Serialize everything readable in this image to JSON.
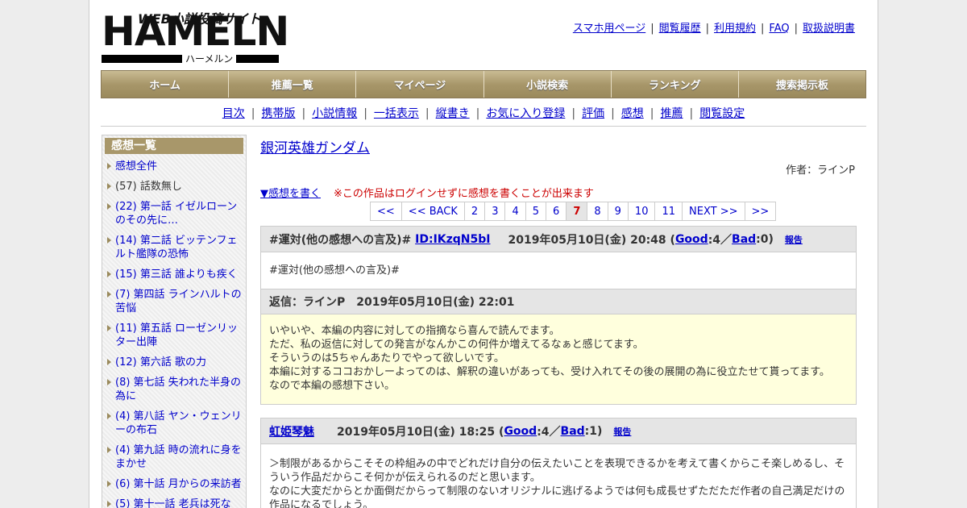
{
  "logo": {
    "main": "HAMELN",
    "web": "WEB小説投稿サイト",
    "kana": "ハーメルン"
  },
  "toplinks": [
    "スマホ用ページ",
    "閲覧履歴",
    "利用規約",
    "FAQ",
    "取扱説明書"
  ],
  "gnav": [
    "ホーム",
    "推薦一覧",
    "マイページ",
    "小説検索",
    "ランキング",
    "捜索掲示板"
  ],
  "subnav": [
    "目次",
    "携帯版",
    "小説情報",
    "一括表示",
    "縦書き",
    "お気に入り登録",
    "評価",
    "感想",
    "推薦",
    "閲覧設定"
  ],
  "sidebar": {
    "title": "感想一覧",
    "items": [
      {
        "label": "感想全件",
        "link": true
      },
      {
        "label": "(57) 話数無し",
        "link": false
      },
      {
        "label": "(22) 第一話 イゼルローンのその先に…",
        "link": true
      },
      {
        "label": "(14) 第二話 ビッテンフェルト艦隊の恐怖",
        "link": true
      },
      {
        "label": "(15) 第三話 誰よりも疾く",
        "link": true
      },
      {
        "label": "(7) 第四話 ラインハルトの苦悩",
        "link": true
      },
      {
        "label": "(11) 第五話 ローゼンリッター出陣",
        "link": true
      },
      {
        "label": "(12) 第六話 歌の力",
        "link": true
      },
      {
        "label": "(8) 第七話 失われた半身の為に",
        "link": true
      },
      {
        "label": "(4) 第八話 ヤン・ウェンリーの布石",
        "link": true
      },
      {
        "label": "(4) 第九話 時の流れに身をまかせ",
        "link": true
      },
      {
        "label": "(6) 第十話 月からの来訪者",
        "link": true
      },
      {
        "label": "(5) 第十一話 老兵は死な",
        "link": true
      }
    ]
  },
  "main": {
    "title": "銀河英雄ガンダム",
    "author": "作者：ラインP",
    "write_link": "▼感想を書く",
    "write_note": "※この作品はログインせずに感想を書くことが出来ます",
    "pager": [
      "<<",
      "<< BACK",
      "2",
      "3",
      "4",
      "5",
      "6",
      "7",
      "8",
      "9",
      "10",
      "11",
      "NEXT >>",
      ">>"
    ],
    "pager_current": "7"
  },
  "comments": [
    {
      "user": "#運対(他の感想への言及)#",
      "id": "ID:IKzqN5bI",
      "date_prefix": "2019年05月10日(金) 20:48 (",
      "good_label": "Good",
      "good_count": ":4／",
      "bad_label": "Bad",
      "bad_count": ":0)",
      "report": "報告",
      "body": "#運対(他の感想への言及)#",
      "reply_head": "返信：ラインP　2019年05月10日(金) 22:01",
      "reply_lines": [
        "いやいや、本編の内容に対しての指摘なら喜んで読んでます。",
        "ただ、私の返信に対しての発言がなんかこの何件か増えてるなぁと感じてます。",
        "そういうのは5ちゃんあたりでやって欲しいです。",
        "本編に対するココおかしーよってのは、解釈の違いがあっても、受け入れてその後の展開の為に役立たせて貰ってます。",
        "なので本編の感想下さい。"
      ]
    },
    {
      "user": "虹姫琴魅",
      "date_prefix": "2019年05月10日(金) 18:25 (",
      "good_label": "Good",
      "good_count": ":4／",
      "bad_label": "Bad",
      "bad_count": ":1)",
      "report": "報告",
      "body_lines": [
        "＞制限があるからこそその枠組みの中でどれだけ自分の伝えたいことを表現できるかを考えて書くからこそ楽しめるし、そういう作品だからこそ何かが伝えられるのだと思います。",
        "なのに大変だからとか面倒だからって制限のないオリジナルに逃げるようでは何も成長せずただただ作者の自己満足だけの作品になるでしょう。"
      ]
    }
  ]
}
